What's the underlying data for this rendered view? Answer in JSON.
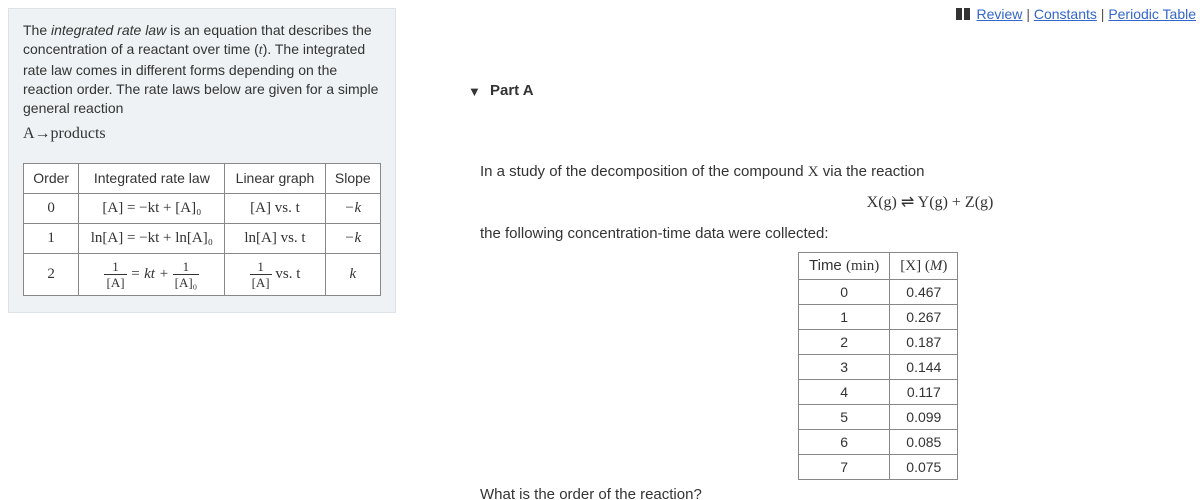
{
  "topLinks": {
    "review": "Review",
    "constants": "Constants",
    "periodicTable": "Periodic Table"
  },
  "intro": {
    "line1a": "The ",
    "line1ital": "integrated rate law",
    "line1b": " is an equation that describes the concentration of a reactant over time (",
    "tvar": "t",
    "line1c": "). The integrated rate law comes in different forms depending on the reaction order. The rate laws below are given for a simple general reaction",
    "reaction": "A→products"
  },
  "rateTable": {
    "headers": {
      "order": "Order",
      "law": "Integrated rate law",
      "graph": "Linear graph",
      "slope": "Slope"
    },
    "rows": [
      {
        "order": "0",
        "law": "[A] = −kt + [A]₀",
        "graph": "[A] vs.  t",
        "slope": "−k"
      },
      {
        "order": "1",
        "law": "ln[A] = −kt + ln[A]₀",
        "graph": "ln[A] vs.  t",
        "slope": "−k"
      },
      {
        "order": "2",
        "lawFracNum1": "1",
        "lawFracDen1": "[A]",
        "lawMid": " = kt + ",
        "lawFracNum2": "1",
        "lawFracDen2": "[A]₀",
        "graphFracNum": "1",
        "graphFracDen": "[A]",
        "graphRest": " vs.  t",
        "slope": "k"
      }
    ]
  },
  "partA": {
    "label": "Part A",
    "prompt1": "In a study of the decomposition of the compound ",
    "promptX": "X",
    "prompt1b": " via the reaction",
    "reaction": "X(g) ⇌ Y(g) + Z(g)",
    "prompt2": "the following concentration-time data were collected:"
  },
  "dataTable": {
    "headers": {
      "time": "Time (min)",
      "conc": "[X] (M)"
    },
    "rows": [
      [
        "0",
        "0.467"
      ],
      [
        "1",
        "0.267"
      ],
      [
        "2",
        "0.187"
      ],
      [
        "3",
        "0.144"
      ],
      [
        "4",
        "0.117"
      ],
      [
        "5",
        "0.099"
      ],
      [
        "6",
        "0.085"
      ],
      [
        "7",
        "0.075"
      ]
    ]
  },
  "cutoffQuestion": "What is the order of the reaction?"
}
